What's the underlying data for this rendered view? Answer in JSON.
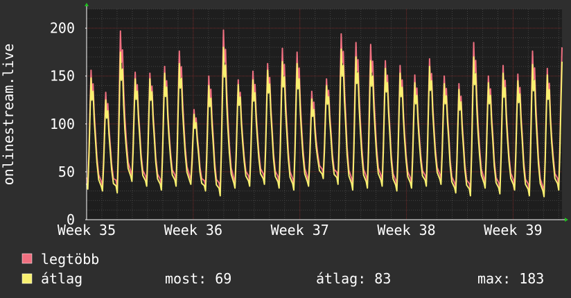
{
  "chart_data": {
    "type": "line",
    "ylabel": "onlinestream.live",
    "ylim": [
      0,
      220
    ],
    "yticks": [
      0,
      50,
      100,
      150,
      200
    ],
    "xlim": [
      0,
      700
    ],
    "xticks": [
      {
        "label": "Week 35",
        "x": 0
      },
      {
        "label": "Week 36",
        "x": 157
      },
      {
        "label": "Week 37",
        "x": 314
      },
      {
        "label": "Week 38",
        "x": 471
      },
      {
        "label": "Week 39",
        "x": 628
      }
    ],
    "grid": true,
    "series": [
      {
        "name": "legtöbb",
        "color": "#f07080",
        "day_peaks": [
          156,
          133,
          197,
          154,
          153,
          160,
          176,
          115,
          150,
          198,
          146,
          155,
          163,
          179,
          175,
          134,
          147,
          194,
          185,
          183,
          166,
          161,
          151,
          168,
          150,
          142,
          185,
          150,
          161,
          152,
          176,
          158,
          180
        ],
        "day_troughs": [
          38,
          35,
          33,
          45,
          40,
          36,
          40,
          42,
          35,
          30,
          38,
          40,
          42,
          38,
          36,
          40,
          48,
          42,
          36,
          38,
          40,
          35,
          38,
          40,
          42,
          33,
          30,
          38,
          32,
          36,
          30,
          28,
          36
        ]
      },
      {
        "name": "átlag",
        "color": "#f8f070",
        "day_peaks": [
          148,
          125,
          175,
          147,
          147,
          153,
          163,
          110,
          140,
          180,
          141,
          146,
          156,
          165,
          163,
          126,
          140,
          178,
          170,
          166,
          158,
          153,
          143,
          160,
          142,
          136,
          170,
          143,
          153,
          145,
          162,
          151,
          165
        ],
        "day_troughs": [
          32,
          30,
          28,
          40,
          35,
          31,
          35,
          37,
          30,
          25,
          33,
          35,
          37,
          33,
          31,
          35,
          43,
          37,
          31,
          33,
          35,
          30,
          33,
          35,
          37,
          28,
          25,
          33,
          27,
          31,
          25,
          24,
          31
        ]
      }
    ],
    "legend": {
      "placement": "bottom",
      "items": [
        {
          "label": "legtöbb",
          "color": "#f07080"
        },
        {
          "label": "átlag",
          "color": "#f8f070"
        }
      ]
    },
    "stats": {
      "most": "most: 69",
      "atlag": "átlag: 83",
      "max": "max: 183"
    }
  },
  "colors": {
    "background": "#2e2e2e",
    "plot_background": "#1e1e1e",
    "grid_major": "#7a2a2a",
    "grid_minor": "#444444",
    "text": "#ffffff",
    "arrow": "#20c020"
  }
}
